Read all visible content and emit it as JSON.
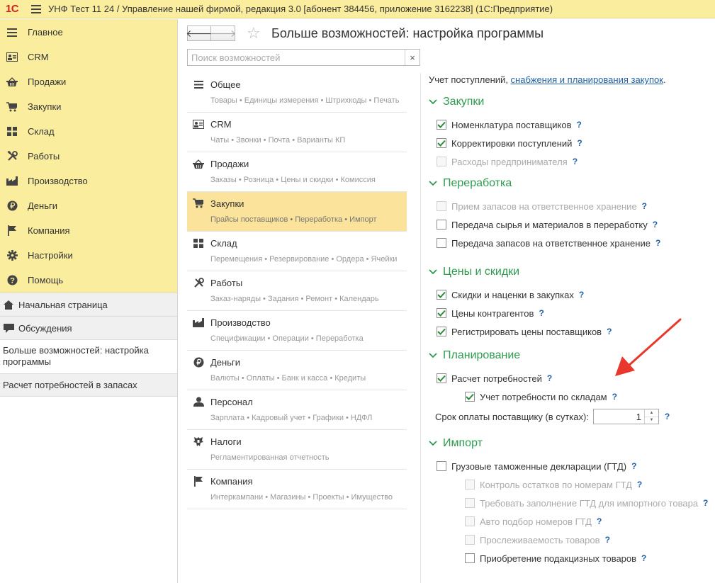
{
  "app": {
    "logo": "1С",
    "title": "УНФ Тест 11 24 / Управление нашей фирмой, редакция 3.0 [абонент 384456, приложение 3162238]  (1С:Предприятие)"
  },
  "sidebar": {
    "items": [
      {
        "label": "Главное",
        "icon": "list-icon"
      },
      {
        "label": "CRM",
        "icon": "contact-card-icon"
      },
      {
        "label": "Продажи",
        "icon": "basket-icon"
      },
      {
        "label": "Закупки",
        "icon": "cart-icon"
      },
      {
        "label": "Склад",
        "icon": "warehouse-icon"
      },
      {
        "label": "Работы",
        "icon": "tools-icon"
      },
      {
        "label": "Производство",
        "icon": "factory-icon"
      },
      {
        "label": "Деньги",
        "icon": "ruble-icon"
      },
      {
        "label": "Компания",
        "icon": "flag-icon"
      },
      {
        "label": "Настройки",
        "icon": "gear-icon"
      },
      {
        "label": "Помощь",
        "icon": "help-icon"
      }
    ],
    "nav": {
      "home": "Начальная страница",
      "discussions": "Обсуждения",
      "open_tab": "Больше возможностей: настройка программы",
      "tab2": "Расчет потребностей в запасах"
    }
  },
  "header": {
    "title": "Больше возможностей: настройка программы",
    "back": "🡐",
    "forward": "🡒",
    "star": "☆"
  },
  "search": {
    "placeholder": "Поиск возможностей",
    "clear": "×"
  },
  "sections": [
    {
      "title": "Общее",
      "sub": "Товары • Единицы измерения • Штрихкоды • Печать"
    },
    {
      "title": "CRM",
      "sub": "Чаты • Звонки • Почта • Варианты КП"
    },
    {
      "title": "Продажи",
      "sub": "Заказы • Розница • Цены и скидки • Комиссия"
    },
    {
      "title": "Закупки",
      "sub": "Прайсы поставщиков • Переработка • Импорт",
      "active": true
    },
    {
      "title": "Склад",
      "sub": "Перемещения • Резервирование • Ордера • Ячейки"
    },
    {
      "title": "Работы",
      "sub": "Заказ-наряды • Задания • Ремонт • Календарь"
    },
    {
      "title": "Производство",
      "sub": "Спецификации • Операции • Переработка"
    },
    {
      "title": "Деньги",
      "sub": "Валюты • Оплаты • Банк и касса • Кредиты"
    },
    {
      "title": "Персонал",
      "sub": "Зарплата • Кадровый учет • Графики • НДФЛ"
    },
    {
      "title": "Налоги",
      "sub": "Регламентированная отчетность"
    },
    {
      "title": "Компания",
      "sub": "Интеркампани • Магазины • Проекты • Имущество"
    }
  ],
  "settings": {
    "intro_text": "Учет поступлений, ",
    "intro_link": "снабжения и планирования закупок",
    "intro_end": ".",
    "help": "?",
    "groups": {
      "zakupki": {
        "title": "Закупки",
        "options": [
          {
            "label": "Номенклатура поставщиков",
            "checked": true,
            "disabled": false
          },
          {
            "label": "Корректировки поступлений",
            "checked": true,
            "disabled": false
          },
          {
            "label": "Расходы предпринимателя",
            "checked": false,
            "disabled": true
          }
        ]
      },
      "pererabotka": {
        "title": "Переработка",
        "options": [
          {
            "label": "Прием запасов на ответственное хранение",
            "checked": false,
            "disabled": true
          },
          {
            "label": "Передача сырья и материалов в переработку",
            "checked": false,
            "disabled": false
          },
          {
            "label": "Передача запасов на ответственное хранение",
            "checked": false,
            "disabled": false
          }
        ]
      },
      "ceny": {
        "title": "Цены и скидки",
        "options": [
          {
            "label": "Скидки и наценки в закупках",
            "checked": true,
            "disabled": false
          },
          {
            "label": "Цены контрагентов",
            "checked": true,
            "disabled": false
          },
          {
            "label": "Регистрировать цены поставщиков",
            "checked": true,
            "disabled": false
          }
        ]
      },
      "planirovanie": {
        "title": "Планирование",
        "options": [
          {
            "label": "Расчет потребностей",
            "checked": true,
            "disabled": false
          },
          {
            "label": "Учет потребности по складам",
            "checked": true,
            "disabled": false
          }
        ],
        "payment_term_label": "Срок оплаты поставщику (в сутках):",
        "payment_term_value": "1"
      },
      "import": {
        "title": "Импорт",
        "options": [
          {
            "label": "Грузовые таможенные декларации (ГТД)",
            "checked": false,
            "disabled": false
          },
          {
            "label": "Контроль остатков по номерам ГТД",
            "checked": false,
            "disabled": true
          },
          {
            "label": "Требовать заполнение ГТД для импортного товара",
            "checked": false,
            "disabled": true
          },
          {
            "label": "Авто подбор номеров ГТД",
            "checked": false,
            "disabled": true
          },
          {
            "label": "Прослеживаемость товаров",
            "checked": false,
            "disabled": true
          },
          {
            "label": "Приобретение подакцизных товаров",
            "checked": false,
            "disabled": false
          }
        ]
      }
    }
  },
  "colors": {
    "accent_yellow": "#fbed9e",
    "active_section": "#fbe39b",
    "group_green": "#2e9b50",
    "link_blue": "#2260a6",
    "arrow_red": "#e8372c",
    "logo_red": "#d3221e"
  }
}
